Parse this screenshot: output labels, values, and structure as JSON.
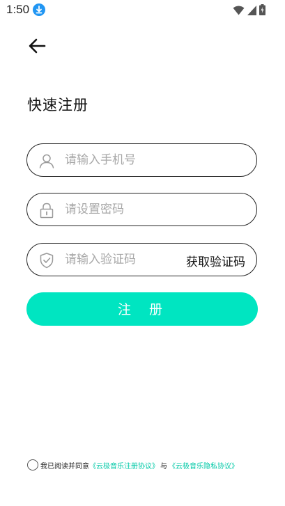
{
  "status_bar": {
    "time": "1:50"
  },
  "page": {
    "title": "快速注册"
  },
  "form": {
    "phone_placeholder": "请输入手机号",
    "password_placeholder": "请设置密码",
    "code_placeholder": "请输入验证码",
    "get_code_label": "获取验证码",
    "register_label": "注 册"
  },
  "agreement": {
    "prefix": "我已阅读并同意",
    "terms_link": "《云极音乐注册协议》",
    "and": "与",
    "privacy_link": "《云极音乐隐私协议》"
  },
  "colors": {
    "accent": "#00e5c1",
    "link": "#00c9a7",
    "download_badge": "#2196f3"
  },
  "icons": [
    "download-icon",
    "wifi-icon",
    "signal-icon",
    "battery-icon",
    "back-arrow-icon",
    "user-icon",
    "lock-icon",
    "shield-check-icon"
  ]
}
